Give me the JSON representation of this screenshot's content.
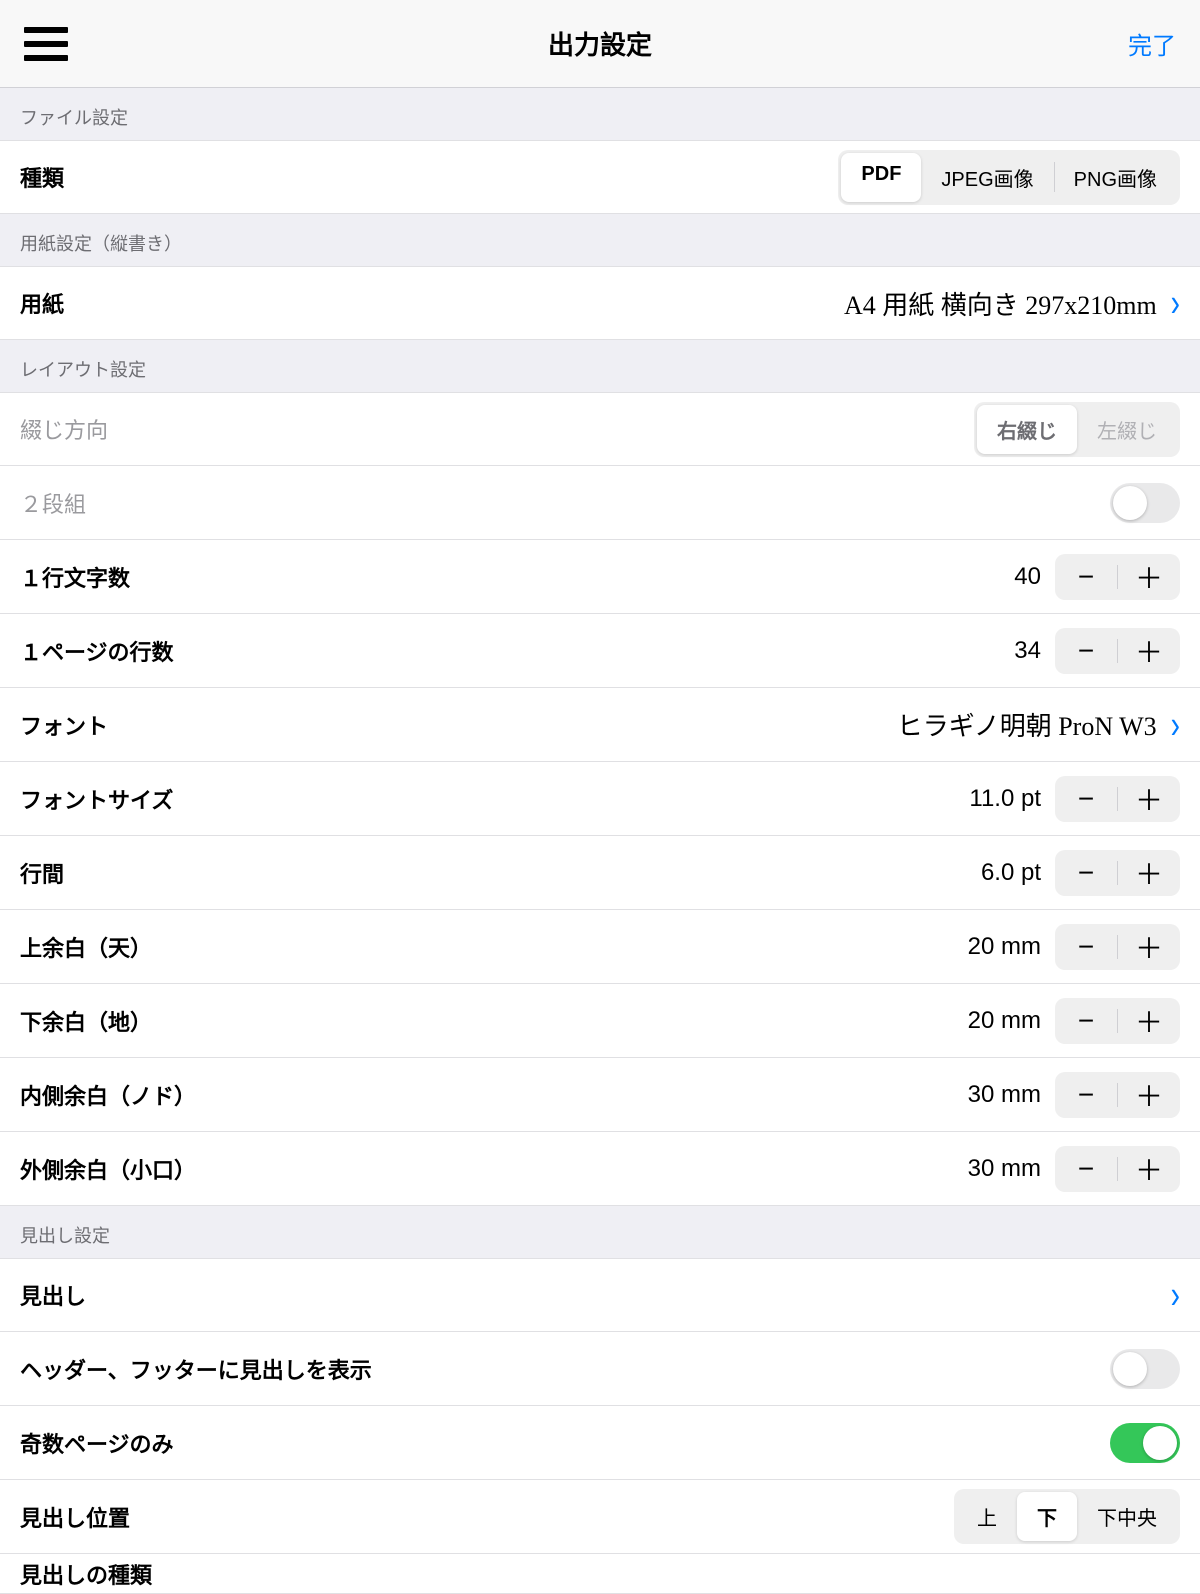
{
  "header": {
    "title": "出力設定",
    "done": "完了"
  },
  "sections": {
    "file": {
      "header": "ファイル設定",
      "type_label": "種類",
      "type_options": [
        "PDF",
        "JPEG画像",
        "PNG画像"
      ],
      "type_selected": "PDF"
    },
    "paper": {
      "header": "用紙設定（縦書き）",
      "paper_label": "用紙",
      "paper_value": "A4 用紙 横向き 297x210mm"
    },
    "layout": {
      "header": "レイアウト設定",
      "binding_label": "綴じ方向",
      "binding_options": [
        "右綴じ",
        "左綴じ"
      ],
      "binding_selected": "右綴じ",
      "two_column_label": "２段組",
      "two_column_on": false,
      "chars_per_line_label": "１行文字数",
      "chars_per_line_value": "40",
      "lines_per_page_label": "１ページの行数",
      "lines_per_page_value": "34",
      "font_label": "フォント",
      "font_value": "ヒラギノ明朝 ProN W3",
      "font_size_label": "フォントサイズ",
      "font_size_value": "11.0 pt",
      "line_spacing_label": "行間",
      "line_spacing_value": "6.0 pt",
      "margin_top_label": "上余白（天）",
      "margin_top_value": "20 mm",
      "margin_bottom_label": "下余白（地）",
      "margin_bottom_value": "20 mm",
      "margin_inner_label": "内側余白（ノド）",
      "margin_inner_value": "30 mm",
      "margin_outer_label": "外側余白（小口）",
      "margin_outer_value": "30 mm"
    },
    "heading": {
      "header": "見出し設定",
      "heading_label": "見出し",
      "show_in_hf_label": "ヘッダー、フッターに見出しを表示",
      "show_in_hf_on": false,
      "odd_only_label": "奇数ページのみ",
      "odd_only_on": true,
      "position_label": "見出し位置",
      "position_options": [
        "上",
        "下",
        "下中央"
      ],
      "position_selected": "下",
      "kind_label": "見出しの種類"
    }
  }
}
